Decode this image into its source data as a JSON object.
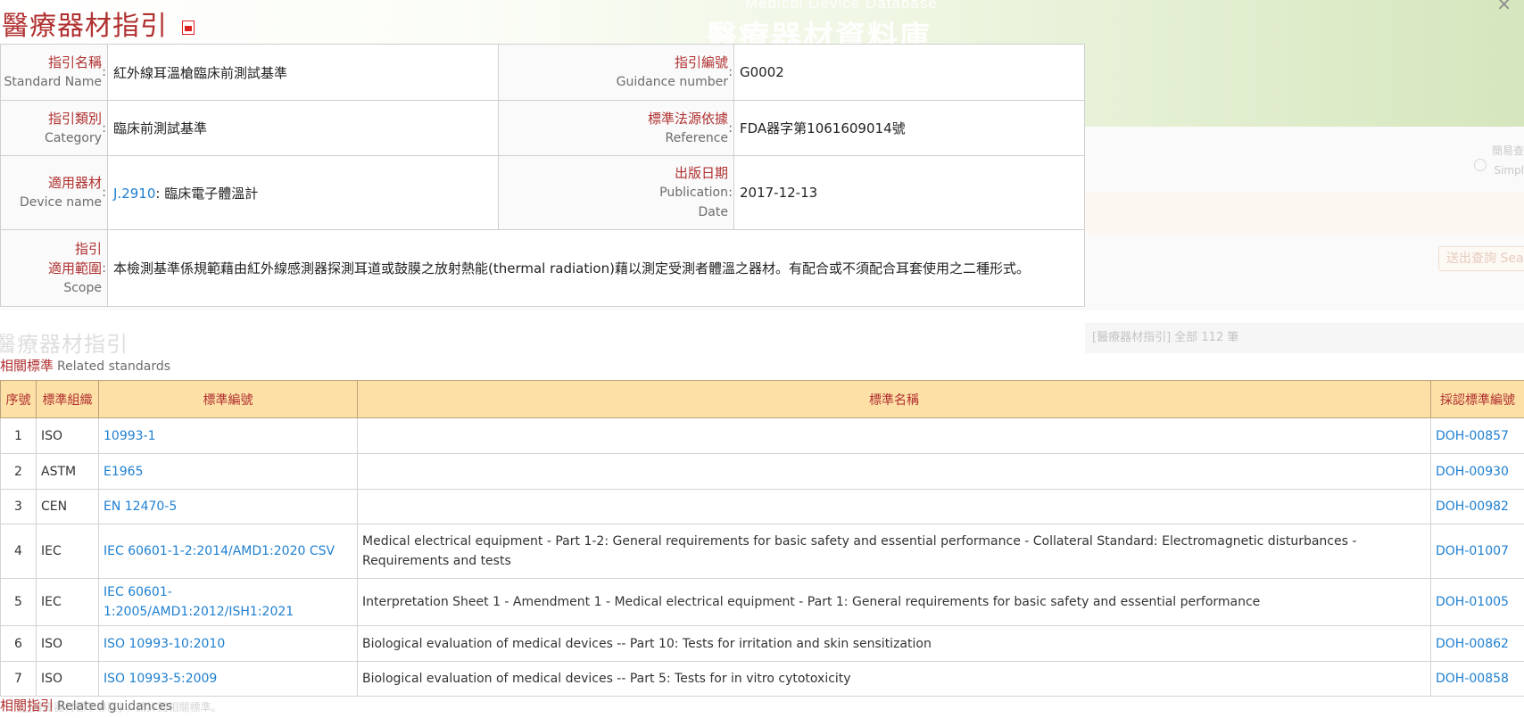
{
  "background": {
    "banner_sub": "Medical Device Database",
    "banner_title": "醫療器材資料庫",
    "close_icon": "×",
    "side_label_1": "簡易查",
    "side_label_2": "Simpl",
    "search_button": "送出查詢 Sea",
    "section_title": "醫療器材指引",
    "count_box": "[醫療器材指引] 全部 112 筆",
    "hint": "[□醫療器材標準專區] ，請詳閱相關標準。"
  },
  "header": {
    "title": "醫療器材指引",
    "pdf_icon": "pdf-icon"
  },
  "info": {
    "standard_name": {
      "label_zh": "指引名稱",
      "label_en": "Standard Name",
      "value": "紅外線耳溫槍臨床前測試基準"
    },
    "guidance_number": {
      "label_zh": "指引編號",
      "label_en": "Guidance number",
      "value": "G0002"
    },
    "category": {
      "label_zh": "指引類別",
      "label_en": "Category",
      "value": "臨床前測試基準"
    },
    "reference": {
      "label_zh": "標準法源依據",
      "label_en": "Reference",
      "value": "FDA器字第1061609014號"
    },
    "device_name": {
      "label_zh": "適用器材",
      "label_en": "Device name",
      "code": "J.2910",
      "value": ": 臨床電子體溫計"
    },
    "publication_date": {
      "label_zh": "出版日期",
      "label_en_1": "Publication",
      "label_en_2": "Date",
      "value": "2017-12-13"
    },
    "scope": {
      "label_zh_1": "指引",
      "label_zh_2": "適用範圍",
      "label_en": "Scope",
      "value": "本檢測基準係規範藉由紅外線感測器探測耳道或鼓膜之放射熱能(thermal radiation)藉以測定受測者體溫之器材。有配合或不須配合耳套使用之二種形式。"
    }
  },
  "related_standards": {
    "title_zh": "相關標準",
    "title_en": "Related standards",
    "columns": [
      "序號",
      "標準組織",
      "標準編號",
      "標準名稱",
      "採認標準編號"
    ],
    "rows": [
      {
        "no": "1",
        "org": "ISO",
        "code": "10993-1",
        "name": "",
        "doh": "DOH-00857"
      },
      {
        "no": "2",
        "org": "ASTM",
        "code": "E1965",
        "name": "",
        "doh": "DOH-00930"
      },
      {
        "no": "3",
        "org": "CEN",
        "code": "EN 12470-5",
        "name": "",
        "doh": "DOH-00982"
      },
      {
        "no": "4",
        "org": "IEC",
        "code": "IEC 60601-1-2:2014/AMD1:2020 CSV",
        "name": "Medical electrical equipment - Part 1-2: General requirements for basic safety and essential performance - Collateral Standard: Electromagnetic disturbances - Requirements and tests",
        "doh": "DOH-01007"
      },
      {
        "no": "5",
        "org": "IEC",
        "code": "IEC 60601-1:2005/AMD1:2012/ISH1:2021",
        "name": "Interpretation Sheet 1 - Amendment 1 - Medical electrical equipment - Part 1: General requirements for basic safety and essential performance",
        "doh": "DOH-01005"
      },
      {
        "no": "6",
        "org": "ISO",
        "code": "ISO 10993-10:2010",
        "name": "Biological evaluation of medical devices -- Part 10: Tests for irritation and skin sensitization",
        "doh": "DOH-00862"
      },
      {
        "no": "7",
        "org": "ISO",
        "code": "ISO 10993-5:2009",
        "name": "Biological evaluation of medical devices -- Part 5: Tests for in vitro cytotoxicity",
        "doh": "DOH-00858"
      }
    ]
  },
  "related_guidances": {
    "title_zh": "相關指引",
    "title_en": "Related guidances"
  }
}
